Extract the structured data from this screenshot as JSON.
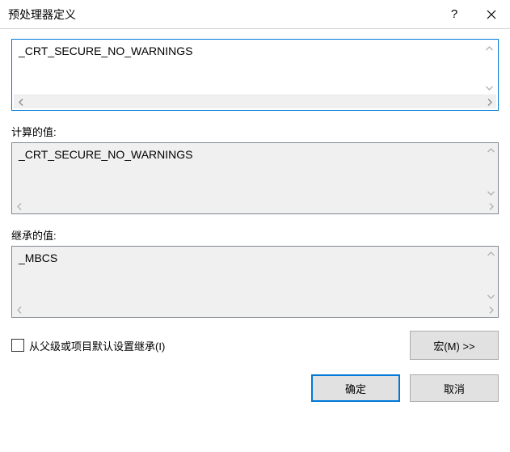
{
  "titlebar": {
    "title": "预处理器定义"
  },
  "editor": {
    "value": "_CRT_SECURE_NO_WARNINGS"
  },
  "computed": {
    "label": "计算的值:",
    "value": "_CRT_SECURE_NO_WARNINGS"
  },
  "inherited": {
    "label": "继承的值:",
    "value": "_MBCS"
  },
  "inherit_checkbox": {
    "label": "从父级或项目默认设置继承(I)"
  },
  "buttons": {
    "macro": "宏(M) >>",
    "ok": "确定",
    "cancel": "取消"
  }
}
